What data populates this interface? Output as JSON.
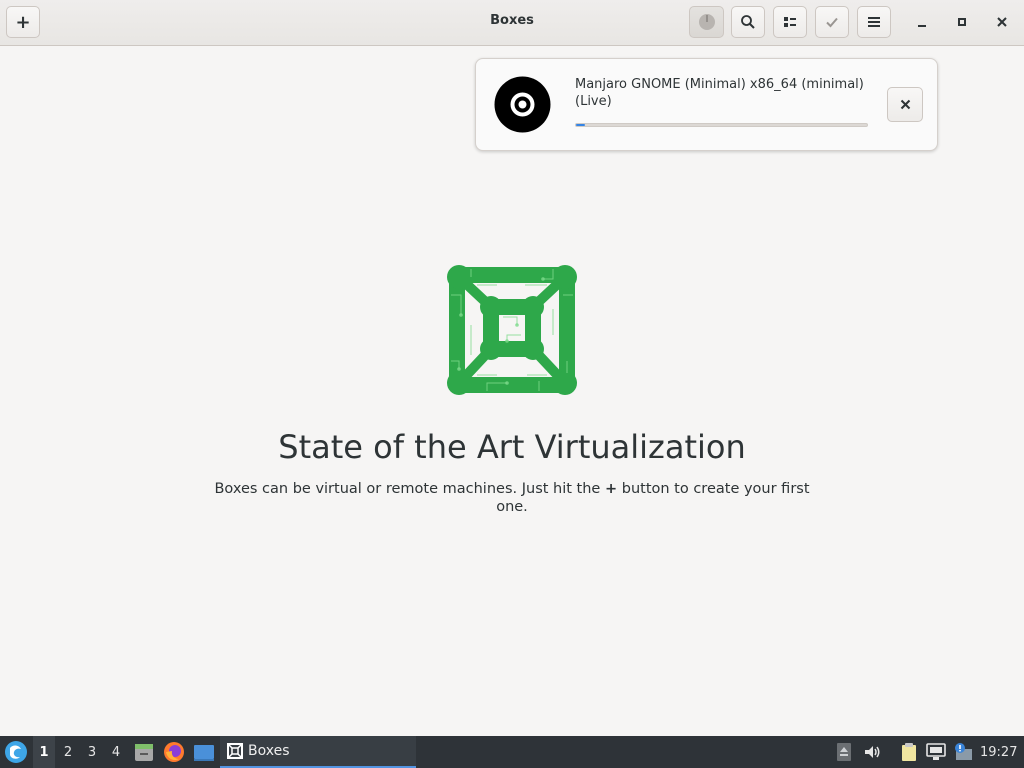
{
  "window": {
    "title": "Boxes"
  },
  "header": {
    "new_label": "+",
    "buttons": [
      "downloads-icon",
      "search-icon",
      "view-list-icon",
      "select-check-icon",
      "menu-icon"
    ]
  },
  "notification": {
    "title": "Manjaro GNOME (Minimal) x86_64 (minimal) (Live)",
    "progress": 0.03,
    "close_icon": "close-icon"
  },
  "empty_state": {
    "title": "State of the Art Virtualization",
    "description_before": "Boxes can be virtual or remote machines. Just hit the ",
    "plus": "+",
    "description_after": " button to create your first one."
  },
  "taskbar": {
    "workspaces": [
      "1",
      "2",
      "3",
      "4"
    ],
    "active_workspace": "1",
    "task_label": "Boxes",
    "clock": "19:27"
  },
  "colors": {
    "accent": "#3584e4",
    "logo_green": "#2ea84a",
    "taskbar": "#2e3338"
  }
}
